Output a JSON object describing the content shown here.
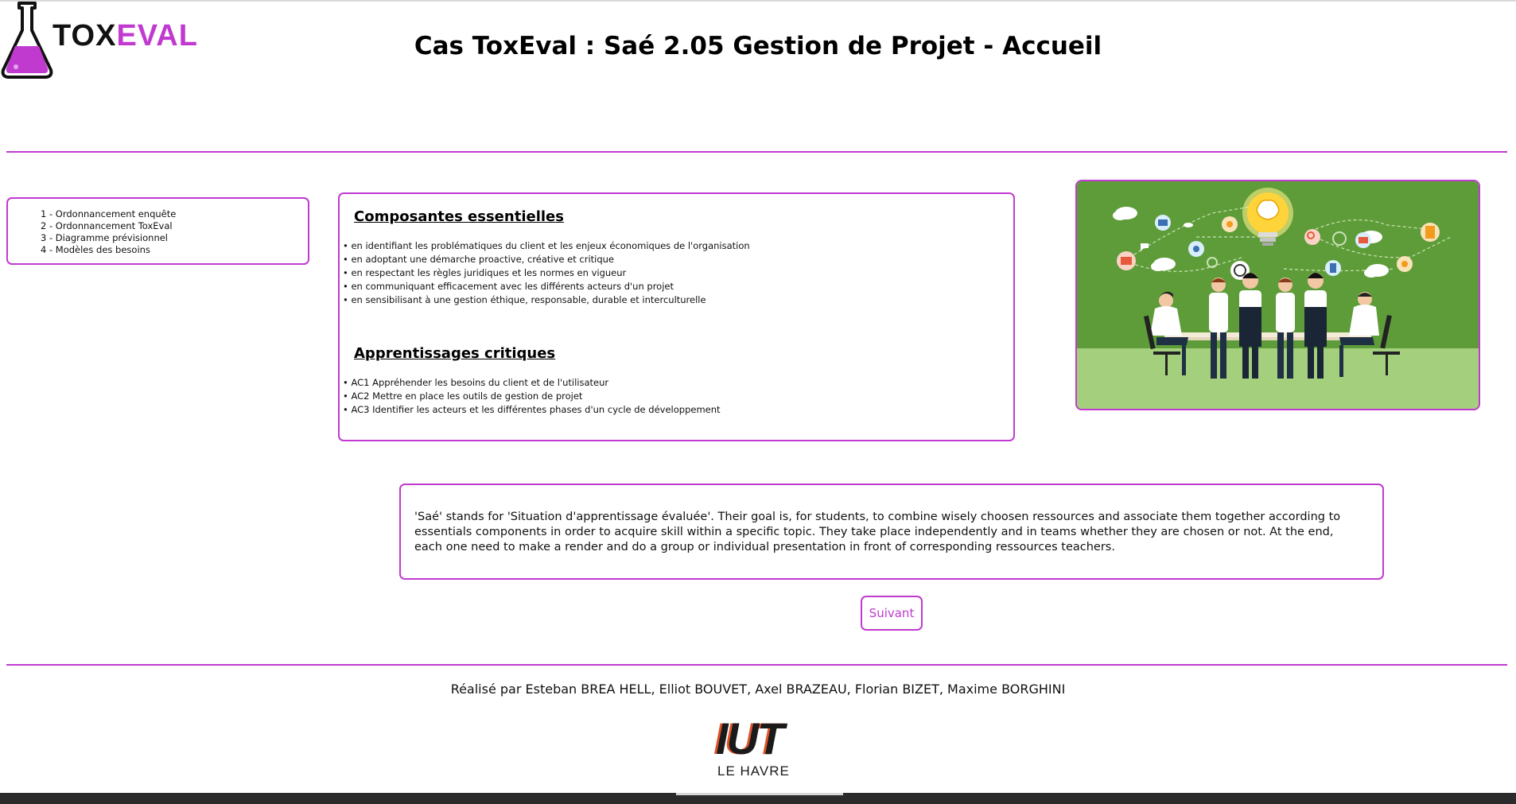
{
  "header": {
    "logo": {
      "part1": "TOX",
      "part2": "EVAL"
    },
    "title": "Cas ToxEval : Saé 2.05 Gestion de Projet - Accueil"
  },
  "nav": {
    "items": [
      {
        "label": "1 - Ordonnancement enquête"
      },
      {
        "label": "2 - Ordonnancement ToxEval"
      },
      {
        "label": "3 - Diagramme prévisionnel"
      },
      {
        "label": "4 - Modèles des besoins"
      }
    ]
  },
  "composantes": {
    "title": "Composantes essentielles",
    "items": [
      "en identifiant les problématiques du client et les enjeux économiques de l'organisation",
      "en adoptant une démarche proactive, créative et critique",
      "en respectant les règles juridiques et les normes en vigueur",
      "en communiquant efficacement avec les différents acteurs d'un projet",
      "en sensibilisant à une gestion éthique, responsable, durable et interculturelle"
    ]
  },
  "apprentissages": {
    "title": "Apprentissages critiques",
    "items": [
      "AC1 Appréhender les besoins du client et de l'utilisateur",
      "AC2 Mettre en place les outils de gestion de projet",
      "AC3 Identifier les acteurs et les différentes phases d'un cycle de développement"
    ]
  },
  "description": {
    "text": "'Saé' stands for 'Situation d'apprentissage évaluée'. Their goal is, for students, to combine wisely choosen ressources and associate them together according to essentials components in order to acquire skill within a specific topic. They take place independently and in teams whether they are chosen or not. At the end, each one need to make a render and do a group or individual presentation in front of corresponding ressources teachers."
  },
  "next_button": {
    "label": "Suivant"
  },
  "footer": {
    "credits": "Réalisé par Esteban BREA HELL, Elliot BOUVET, Axel BRAZEAU, Florian BIZET, Maxime BORGHINI",
    "iut_logo": {
      "main": "IUT",
      "sub": "LE HAVRE"
    }
  },
  "colors": {
    "accent": "#c13ad0",
    "image_green": "#5e9c39",
    "image_floor": "#a4d07d"
  }
}
